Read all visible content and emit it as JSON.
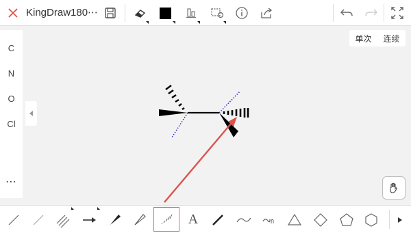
{
  "header": {
    "title": "KingDraw180⋯",
    "icons": [
      "close-icon",
      "save-icon",
      "eraser-icon",
      "color-swatch",
      "align-icon",
      "selection-icon",
      "info-icon",
      "share-icon",
      "undo-icon",
      "redo-icon",
      "fullscreen-icon"
    ],
    "current_color": "#000000"
  },
  "left_panel": {
    "elements": [
      "C",
      "N",
      "O",
      "Cl"
    ],
    "more_label": "⋯"
  },
  "mode_toggle": {
    "single": "单次",
    "continuous": "连续"
  },
  "bottom_toolbar": {
    "tools": [
      "single-bond",
      "light-bond",
      "triple-bond",
      "arrow",
      "wedge-bond",
      "hollow-wedge-bond",
      "hash-bond",
      "text",
      "bold-bond",
      "wavy-line",
      "curved-arrow",
      "triangle",
      "diamond",
      "pentagon",
      "hexagon",
      "more"
    ],
    "selected_tool": "hash-bond",
    "text_tool_label": "A"
  },
  "colors": {
    "accent": "#d9534f",
    "canvas_bg": "#f2f2f2",
    "bond": "#000000",
    "dotted_bond": "#2b2bcf"
  }
}
